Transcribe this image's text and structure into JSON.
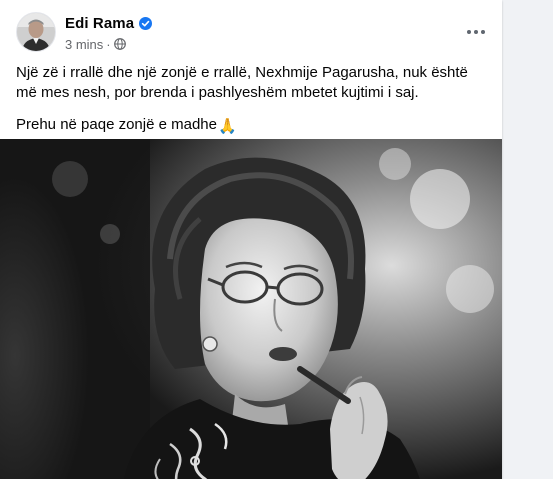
{
  "post": {
    "author": "Edi Rama",
    "timestamp": "3 mins",
    "privacy_icon": "globe-icon",
    "verified_icon": "verified-badge-icon",
    "more_icon": "more-options-icon",
    "paragraphs": [
      "Një zë i rrallë dhe një zonjë e rrallë, Nexhmije Pagarusha, nuk është më mes nesh, por brenda i pashlyeshëm mbetet kujtimi i saj.",
      "Prehu në paqe zonjë e madhe"
    ],
    "trailing_emoji": "🙏",
    "photo_description_icon": "portrait-photo"
  },
  "colors": {
    "accent": "#1877f2",
    "text_primary": "#050505",
    "text_secondary": "#65676b",
    "background": "#f0f2f5"
  }
}
